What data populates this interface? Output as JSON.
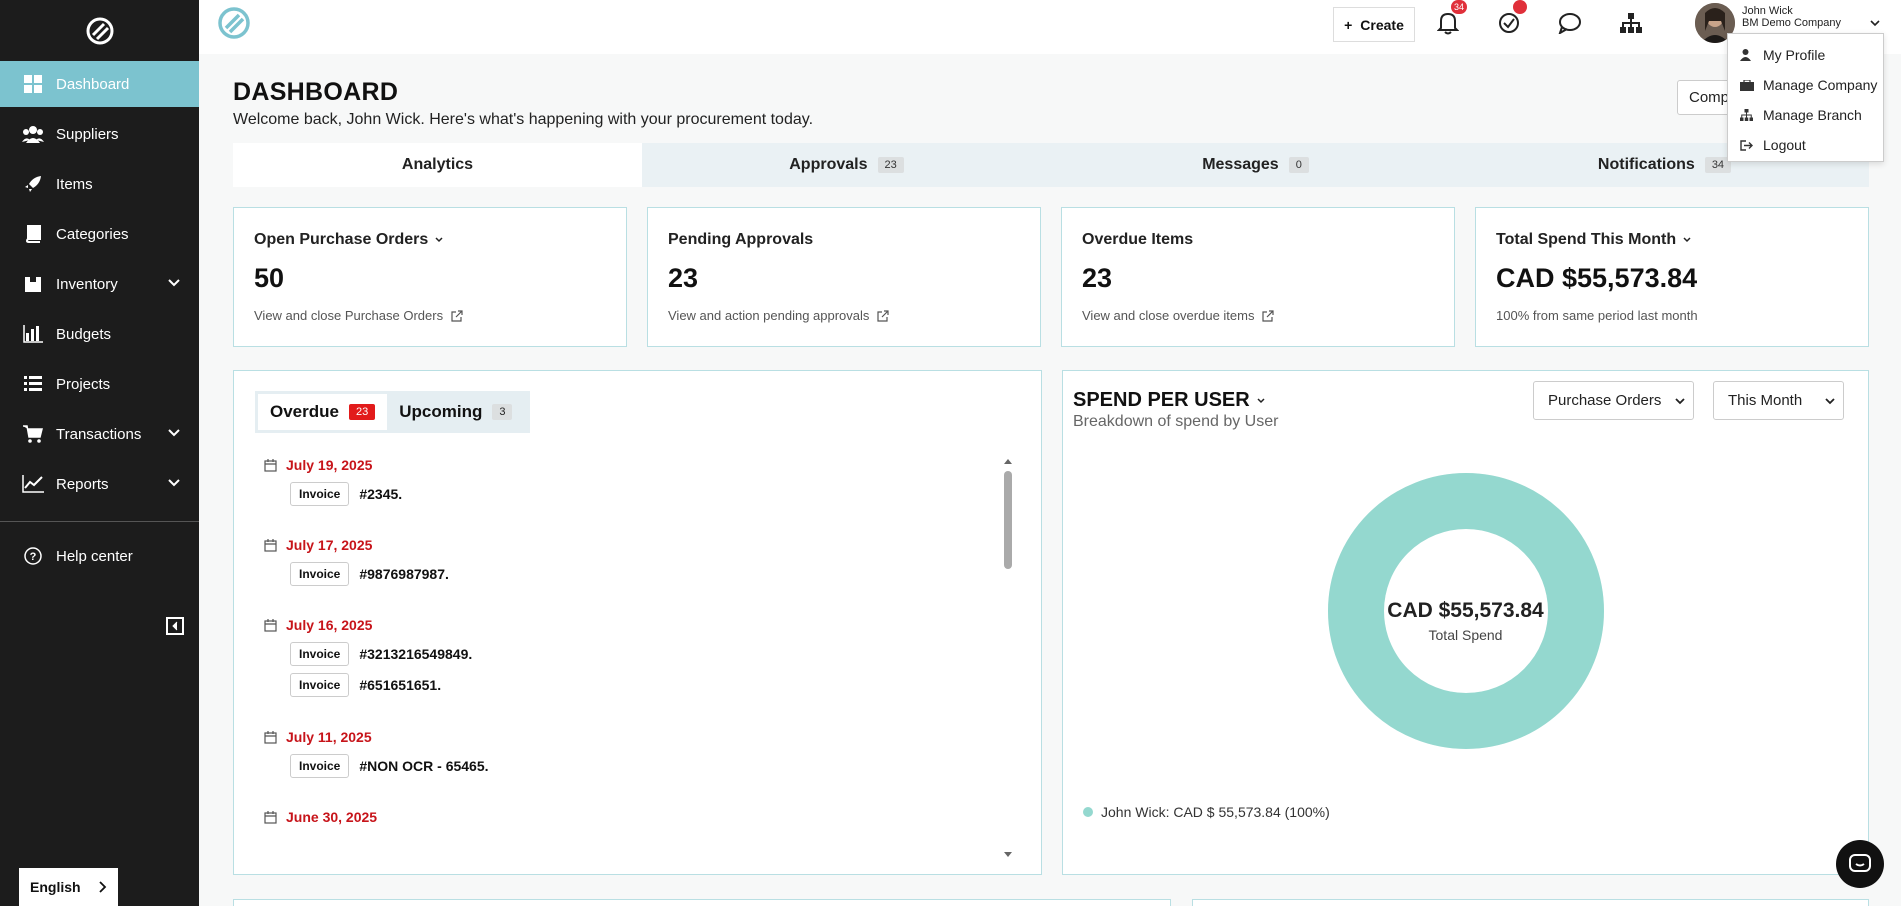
{
  "colors": {
    "accent": "#7cc3cf",
    "sidebar": "#1c1c1c",
    "donut": "#94d8cf",
    "danger": "#c7141a"
  },
  "sidebar": {
    "items": [
      {
        "label": "Dashboard",
        "icon": "grid-icon"
      },
      {
        "label": "Suppliers",
        "icon": "users-icon"
      },
      {
        "label": "Items",
        "icon": "rocket-icon"
      },
      {
        "label": "Categories",
        "icon": "book-icon"
      },
      {
        "label": "Inventory",
        "icon": "box-icon"
      },
      {
        "label": "Budgets",
        "icon": "bar-chart-icon"
      },
      {
        "label": "Projects",
        "icon": "list-icon"
      },
      {
        "label": "Transactions",
        "icon": "cart-icon"
      },
      {
        "label": "Reports",
        "icon": "line-chart-icon"
      }
    ],
    "help": "Help center",
    "language": "English"
  },
  "topbar": {
    "create_label": "Create",
    "notifications_count": "34",
    "user_name": "John Wick",
    "company": "BM Demo Company"
  },
  "user_menu": {
    "items": [
      "My Profile",
      "Manage Company",
      "Manage Branch",
      "Logout"
    ]
  },
  "header": {
    "title": "DASHBOARD",
    "subtitle": "Welcome back, John Wick. Here's what's happening with your procurement today.",
    "compare_button": "Comp"
  },
  "tabs": [
    {
      "label": "Analytics",
      "count": ""
    },
    {
      "label": "Approvals",
      "count": "23"
    },
    {
      "label": "Messages",
      "count": "0"
    },
    {
      "label": "Notifications",
      "count": "34"
    }
  ],
  "cards": [
    {
      "label": "Open Purchase Orders",
      "value": "50",
      "link": "View and close Purchase Orders"
    },
    {
      "label": "Pending Approvals",
      "value": "23",
      "link": "View and action pending approvals"
    },
    {
      "label": "Overdue Items",
      "value": "23",
      "link": "View and close overdue items"
    },
    {
      "label": "Total Spend This Month",
      "value": "CAD $55,573.84",
      "link": "100% from same period last month"
    }
  ],
  "overdue": {
    "tab_overdue": "Overdue",
    "overdue_count": "23",
    "tab_upcoming": "Upcoming",
    "upcoming_count": "3",
    "invoice_tag": "Invoice",
    "groups": [
      {
        "date": "July 19, 2025",
        "items": [
          "#2345."
        ]
      },
      {
        "date": "July 17, 2025",
        "items": [
          "#9876987987."
        ]
      },
      {
        "date": "July 16, 2025",
        "items": [
          "#3213216549849.",
          "#651651651."
        ]
      },
      {
        "date": "July 11, 2025",
        "items": [
          "#NON OCR - 65465."
        ]
      },
      {
        "date": "June 30, 2025",
        "items": []
      }
    ]
  },
  "spend": {
    "title": "SPEND PER USER",
    "subtitle": "Breakdown of spend by User",
    "type_select": "Purchase Orders",
    "period_select": "This Month",
    "center_value": "CAD $55,573.84",
    "center_label": "Total Spend",
    "legend": "John Wick: CAD $ 55,573.84 (100%)",
    "share": 100
  }
}
